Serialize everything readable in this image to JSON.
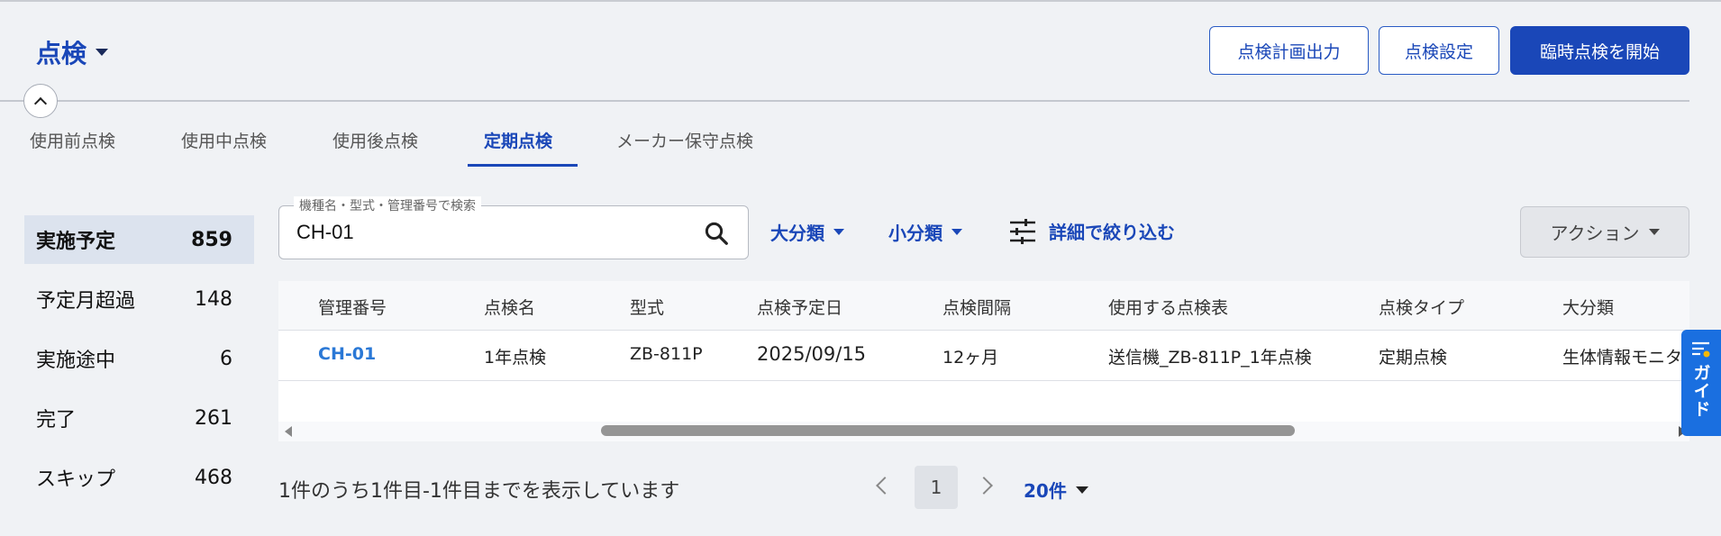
{
  "header": {
    "title": "点検",
    "buttons": {
      "export_plan": "点検計画出力",
      "settings": "点検設定",
      "start_adhoc": "臨時点検を開始"
    }
  },
  "tabs": [
    "使用前点検",
    "使用中点検",
    "使用後点検",
    "定期点検",
    "メーカー保守点検"
  ],
  "active_tab": "定期点検",
  "status_list": [
    {
      "label": "実施予定",
      "count": "859"
    },
    {
      "label": "予定月超過",
      "count": "148"
    },
    {
      "label": "実施途中",
      "count": "6"
    },
    {
      "label": "完了",
      "count": "261"
    },
    {
      "label": "スキップ",
      "count": "468"
    }
  ],
  "search": {
    "label": "機種名・型式・管理番号で検索",
    "value": "CH-01"
  },
  "filters": {
    "major": "大分類",
    "minor": "小分類",
    "detail": "詳細で絞り込む"
  },
  "action_label": "アクション",
  "table": {
    "headers": [
      "管理番号",
      "点検名",
      "型式",
      "点検予定日",
      "点検間隔",
      "使用する点検表",
      "点検タイプ",
      "大分類"
    ],
    "rows": [
      [
        "CH-01",
        "1年点検",
        "ZB-811P",
        "2025/09/15",
        "12ヶ月",
        "送信機_ZB-811P_1年点検",
        "定期点検",
        "生体情報モニタ"
      ]
    ]
  },
  "guide_label": "ガイド",
  "pagination": {
    "summary": "1件のうち1件目-1件目までを表示しています",
    "current_page": "1",
    "page_size": "20件"
  },
  "colors": {
    "accent": "#1a47b8",
    "link": "#2a78d6",
    "guide": "#1a6fe0",
    "background": "#f0f2f5"
  }
}
